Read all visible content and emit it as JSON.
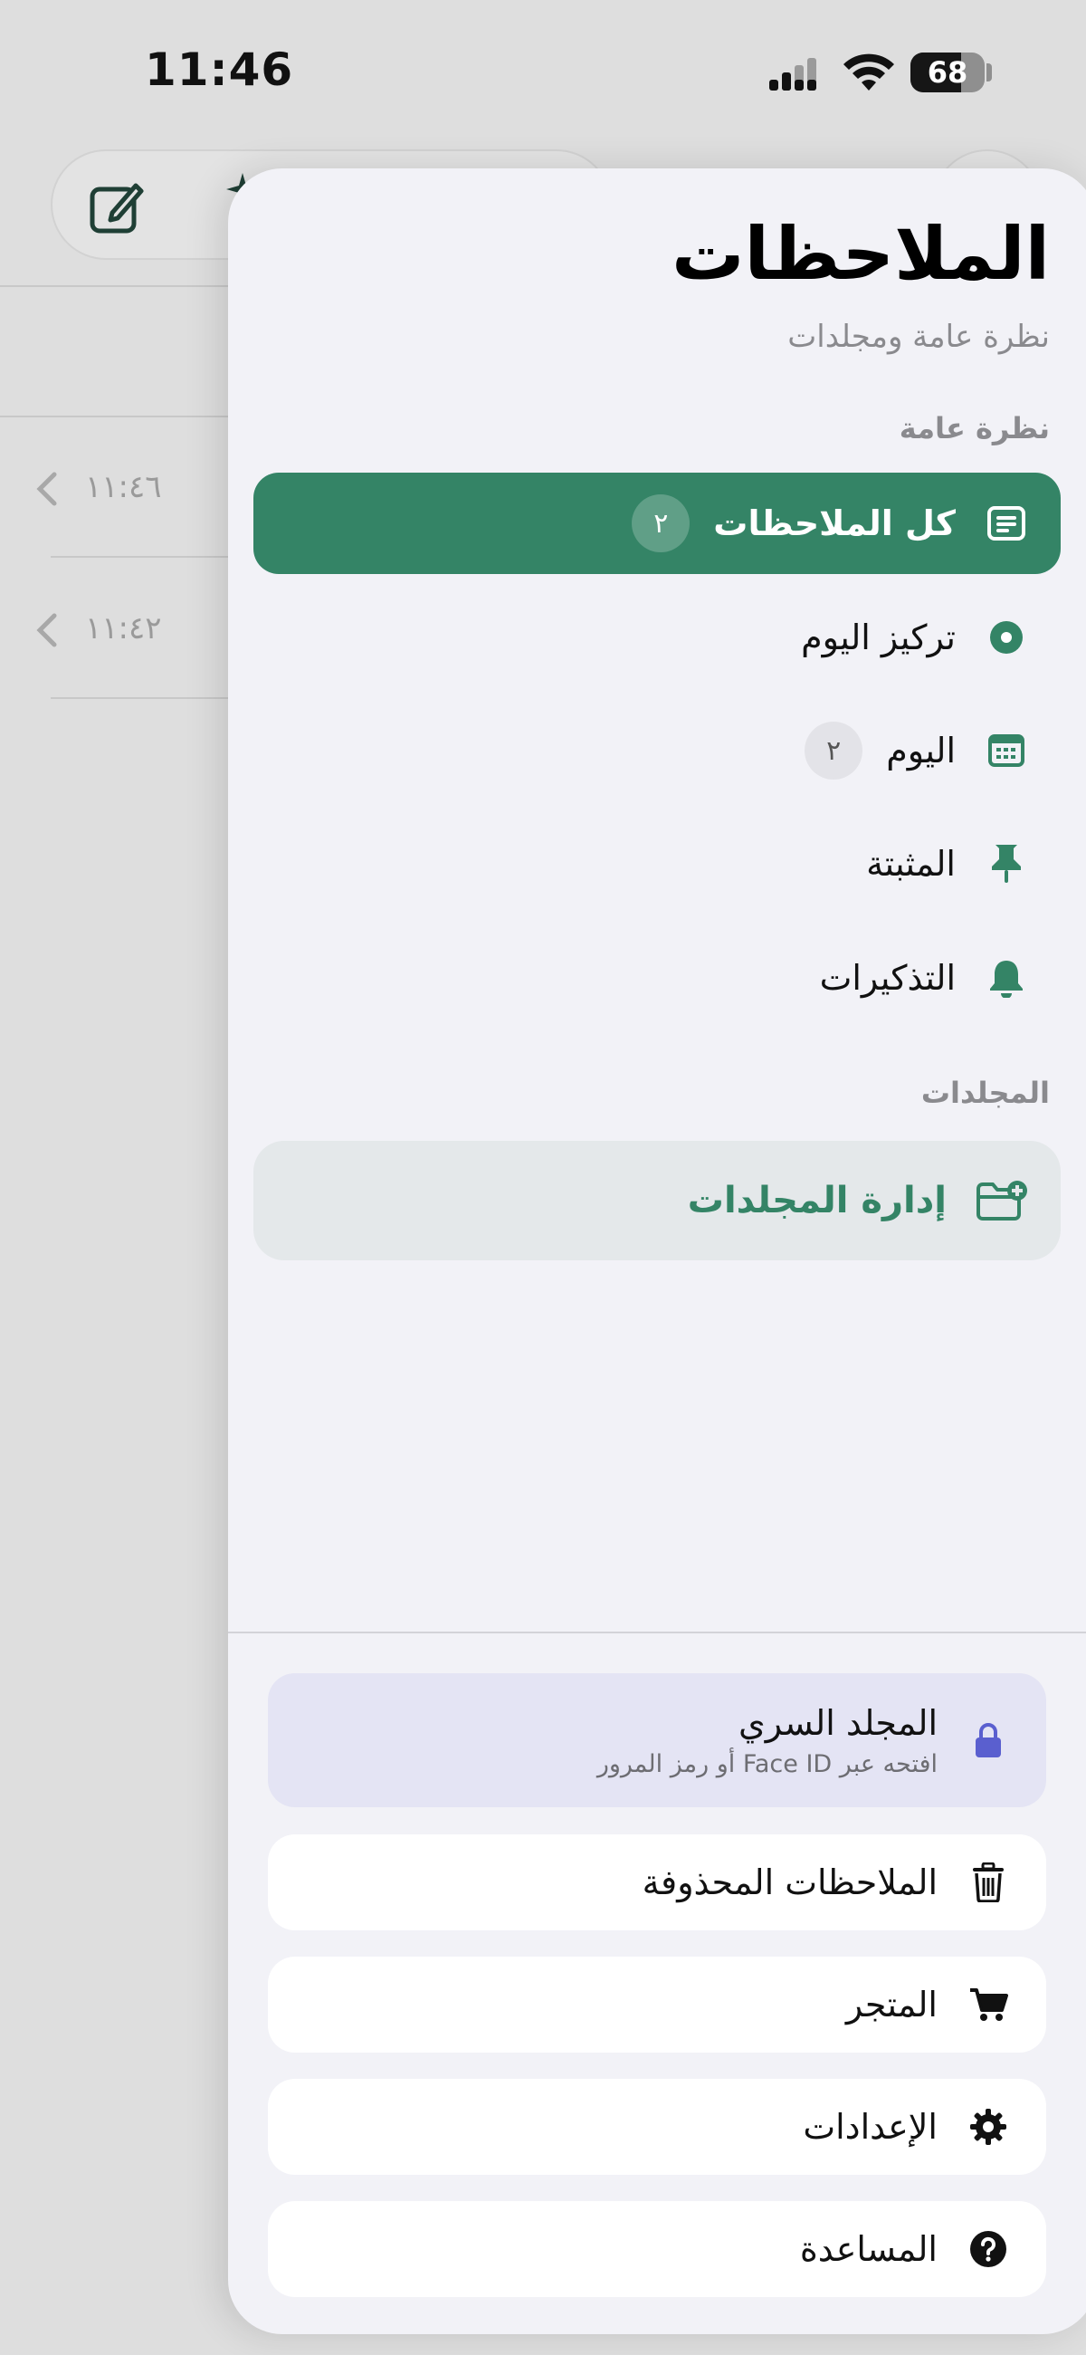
{
  "status_bar": {
    "time": "11:46",
    "battery_level": "68",
    "battery_fraction": 0.68
  },
  "background_list": {
    "rows": [
      {
        "time": "١١:٤٦"
      },
      {
        "time": "١١:٤٢"
      }
    ]
  },
  "panel": {
    "title": "الملاحظات",
    "subtitle": "نظرة عامة ومجلدات",
    "overview_section": "نظرة عامة",
    "nav_items": [
      {
        "label": "كل الملاحظات",
        "badge": "٢",
        "icon": "notes-list-icon",
        "active": true
      },
      {
        "label": "تركيز اليوم",
        "badge": "",
        "icon": "focus-target-icon",
        "active": false
      },
      {
        "label": "اليوم",
        "badge": "٢",
        "icon": "calendar-icon",
        "active": false
      },
      {
        "label": "المثبتة",
        "badge": "",
        "icon": "pin-icon",
        "active": false
      },
      {
        "label": "التذكيرات",
        "badge": "",
        "icon": "bell-icon",
        "active": false
      }
    ],
    "folders_section": "المجلدات",
    "manage_folders_label": "إدارة المجلدات",
    "secret_folder": {
      "title": "المجلد السري",
      "subtitle": "افتحه عبر Face ID أو رمز المرور"
    },
    "bottom_items": [
      {
        "label": "الملاحظات المحذوفة",
        "icon": "trash-icon"
      },
      {
        "label": "المتجر",
        "icon": "cart-icon"
      },
      {
        "label": "الإعدادات",
        "icon": "gear-icon"
      },
      {
        "label": "المساعدة",
        "icon": "help-icon"
      }
    ]
  },
  "colors": {
    "accent": "#348466",
    "panel_bg": "#f2f2f7",
    "secret_bg": "#e4e4f4",
    "lock": "#5a5fcf"
  }
}
